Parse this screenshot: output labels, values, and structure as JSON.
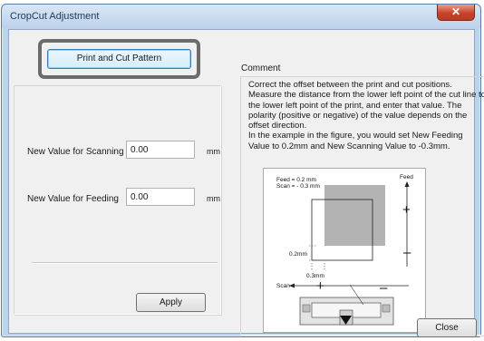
{
  "window": {
    "title": "CropCut Adjustment",
    "close_glyph": "✕"
  },
  "pattern_button": {
    "label": "Print and Cut Pattern"
  },
  "fields": [
    {
      "label": "New Value for Scanning",
      "value": "0.00",
      "unit": "mm"
    },
    {
      "label": "New Value for Feeding",
      "value": "0.00",
      "unit": "mm"
    }
  ],
  "apply_button": {
    "label": "Apply"
  },
  "comment": {
    "title": "Comment",
    "text": "Correct the offset between the print and cut positions. Measure the distance from the lower left point of the cut line to the lower left point of the print, and enter that value. The polarity (positive or negative) of the value depends on the offset direction.\nIn the example in the figure, you would set New Feeding Value to 0.2mm and New Scanning Value to -0.3mm."
  },
  "figure": {
    "feed_line1": "Feed = 0.2 mm",
    "feed_line2": "Scan = - 0.3 mm",
    "feed_axis": "Feed",
    "scan_axis": "Scan",
    "plus": "+",
    "minus": "–",
    "dim_feed": "0.2mm",
    "dim_scan": "0.3mm",
    "down_arrow": "▼"
  },
  "close_button": {
    "label": "Close"
  },
  "colors": {
    "title_text": "#1e395b",
    "close_red": "#c7432b",
    "focus_blue": "#3c7fb1",
    "print_gray": "#b3b3b3"
  }
}
